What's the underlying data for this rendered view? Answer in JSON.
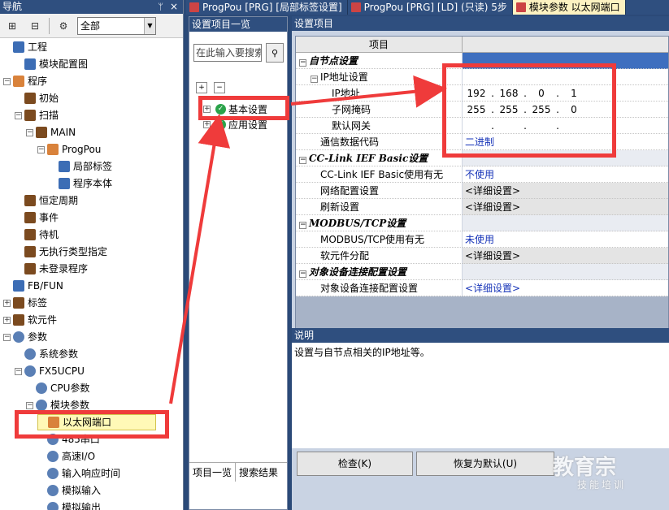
{
  "nav": {
    "title": "导航",
    "pin": "ᛘ",
    "close": "×",
    "filter_value": "全部",
    "items": [
      {
        "label": "工程",
        "level": 0,
        "exp": "",
        "icon": "project-icon",
        "icls": "blue"
      },
      {
        "label": "模块配置图",
        "level": 1,
        "exp": "",
        "icon": "module-config-icon",
        "icls": "blue"
      },
      {
        "label": "程序",
        "level": 0,
        "exp": "−",
        "icon": "program-icon",
        "icls": "orange"
      },
      {
        "label": "初始",
        "level": 1,
        "exp": "",
        "icon": "folder-icon",
        "icls": "folder"
      },
      {
        "label": "扫描",
        "level": 1,
        "exp": "−",
        "icon": "folder-icon",
        "icls": "folder"
      },
      {
        "label": "MAIN",
        "level": 2,
        "exp": "−",
        "icon": "folder-icon",
        "icls": "folder"
      },
      {
        "label": "ProgPou",
        "level": 3,
        "exp": "−",
        "icon": "program-block-icon",
        "icls": "orange"
      },
      {
        "label": "局部标签",
        "level": 4,
        "exp": "",
        "icon": "label-icon",
        "icls": "blue"
      },
      {
        "label": "程序本体",
        "level": 4,
        "exp": "",
        "icon": "program-body-icon",
        "icls": "blue"
      },
      {
        "label": "恒定周期",
        "level": 1,
        "exp": "",
        "icon": "folder-icon",
        "icls": "folder"
      },
      {
        "label": "事件",
        "level": 1,
        "exp": "",
        "icon": "folder-icon",
        "icls": "folder"
      },
      {
        "label": "待机",
        "level": 1,
        "exp": "",
        "icon": "folder-icon",
        "icls": "folder"
      },
      {
        "label": "无执行类型指定",
        "level": 1,
        "exp": "",
        "icon": "folder-icon",
        "icls": "folder"
      },
      {
        "label": "未登录程序",
        "level": 1,
        "exp": "",
        "icon": "folder-icon",
        "icls": "folder"
      },
      {
        "label": "FB/FUN",
        "level": 0,
        "exp": "",
        "icon": "fb-icon",
        "icls": "blue"
      },
      {
        "label": "标签",
        "level": 0,
        "exp": "+",
        "icon": "label-icon",
        "icls": "folder"
      },
      {
        "label": "软元件",
        "level": 0,
        "exp": "+",
        "icon": "device-icon",
        "icls": "folder"
      },
      {
        "label": "参数",
        "level": 0,
        "exp": "−",
        "icon": "parameter-icon",
        "icls": "gear"
      },
      {
        "label": "系统参数",
        "level": 1,
        "exp": "",
        "icon": "system-param-icon",
        "icls": "gear"
      },
      {
        "label": "FX5UCPU",
        "level": 1,
        "exp": "−",
        "icon": "cpu-icon",
        "icls": "gear"
      },
      {
        "label": "CPU参数",
        "level": 2,
        "exp": "",
        "icon": "cpu-param-icon",
        "icls": "gear"
      },
      {
        "label": "模块参数",
        "level": 2,
        "exp": "−",
        "icon": "module-param-icon",
        "icls": "gear"
      },
      {
        "label": "以太网端口",
        "level": 3,
        "exp": "",
        "icon": "ethernet-port-icon",
        "icls": "orange",
        "selected": true
      },
      {
        "label": "485串口",
        "level": 3,
        "exp": "",
        "icon": "serial-port-icon",
        "icls": "gear"
      },
      {
        "label": "高速I/O",
        "level": 3,
        "exp": "",
        "icon": "high-speed-io-icon",
        "icls": "gear"
      },
      {
        "label": "输入响应时间",
        "level": 3,
        "exp": "",
        "icon": "input-response-icon",
        "icls": "gear"
      },
      {
        "label": "模拟输入",
        "level": 3,
        "exp": "",
        "icon": "analog-input-icon",
        "icls": "gear"
      },
      {
        "label": "模拟输出",
        "level": 3,
        "exp": "",
        "icon": "analog-output-icon",
        "icls": "gear"
      }
    ]
  },
  "tabs": [
    {
      "label": "ProgPou [PRG] [局部标签设置]",
      "active": false
    },
    {
      "label": "ProgPou [PRG] [LD] (只读) 5步",
      "active": false
    },
    {
      "label": "模块参数 以太网端口",
      "active": true
    }
  ],
  "settings_list": {
    "title": "设置项目一览",
    "search_placeholder": "在此输入要搜索",
    "search_icon": "binoculars-icon",
    "items": [
      {
        "label": "基本设置"
      },
      {
        "label": "应用设置"
      }
    ],
    "bottom_tabs": [
      "项目一览",
      "搜索结果"
    ]
  },
  "settings": {
    "title": "设置项目",
    "column_item": "项目",
    "rows": [
      {
        "type": "group",
        "label": "自节点设置",
        "value": "",
        "vcls": "blue"
      },
      {
        "type": "sub",
        "label": "IP地址设置",
        "value": "",
        "indent": 1
      },
      {
        "type": "ip",
        "label": "IP地址",
        "ip": [
          "192",
          "168",
          "0",
          "1"
        ],
        "indent": 2
      },
      {
        "type": "ip",
        "label": "子网掩码",
        "ip": [
          "255",
          "255",
          "255",
          "0"
        ],
        "indent": 2
      },
      {
        "type": "ip",
        "label": "默认网关",
        "ip": [
          "",
          "",
          "",
          ""
        ],
        "indent": 2
      },
      {
        "type": "val",
        "label": "通信数据代码",
        "value": "二进制",
        "vcls": "link",
        "indent": 1
      },
      {
        "type": "group",
        "label": "CC-Link IEF Basic设置",
        "value": ""
      },
      {
        "type": "val",
        "label": "CC-Link IEF Basic使用有无",
        "value": "不使用",
        "vcls": "link",
        "indent": 1
      },
      {
        "type": "val",
        "label": "网络配置设置",
        "value": "<详细设置>",
        "vcls": "gray",
        "indent": 1
      },
      {
        "type": "val",
        "label": "刷新设置",
        "value": "<详细设置>",
        "vcls": "gray",
        "indent": 1
      },
      {
        "type": "group",
        "label": "MODBUS/TCP设置",
        "value": ""
      },
      {
        "type": "val",
        "label": "MODBUS/TCP使用有无",
        "value": "未使用",
        "vcls": "link",
        "indent": 1
      },
      {
        "type": "val",
        "label": "软元件分配",
        "value": "<详细设置>",
        "vcls": "gray",
        "indent": 1
      },
      {
        "type": "group",
        "label": "对象设备连接配置设置",
        "value": ""
      },
      {
        "type": "val",
        "label": "对象设备连接配置设置",
        "value": "<详细设置>",
        "vcls": "link",
        "indent": 1
      }
    ],
    "description_title": "说明",
    "description": "设置与自节点相关的IP地址等。",
    "check_button": "检查(K)",
    "restore_button": "恢复为默认(U)"
  },
  "watermark": {
    "line1": "教育宗",
    "line2": "技能培训"
  },
  "colors": {
    "accent": "#2f4f7f",
    "highlight": "#ef3b3b",
    "link": "#1633b8"
  }
}
